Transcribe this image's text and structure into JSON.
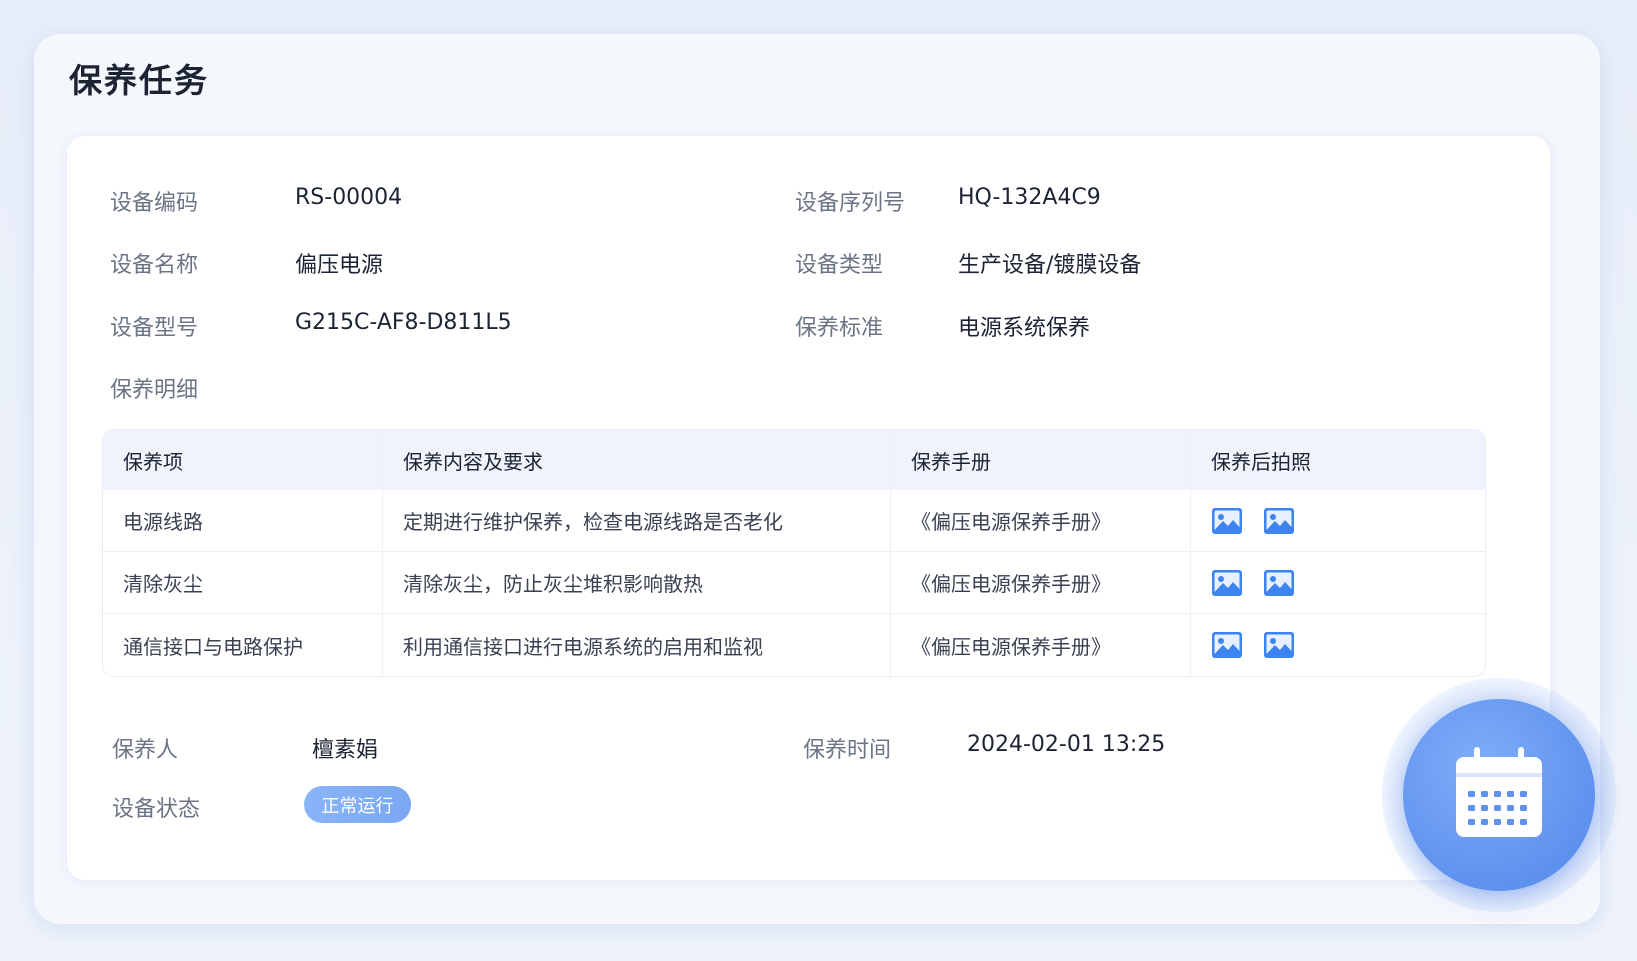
{
  "page": {
    "title": "保养任务"
  },
  "device": {
    "code_label": "设备编码",
    "code_value": "RS-00004",
    "serial_label": "设备序列号",
    "serial_value": "HQ-132A4C9",
    "name_label": "设备名称",
    "name_value": "偏压电源",
    "type_label": "设备类型",
    "type_value": "生产设备/镀膜设备",
    "model_label": "设备型号",
    "model_value": "G215C-AF8-D811L5",
    "standard_label": "保养标准",
    "standard_value": "电源系统保养"
  },
  "details": {
    "label": "保养明细",
    "columns": [
      "保养项",
      "保养内容及要求",
      "保养手册",
      "保养后拍照"
    ],
    "rows": [
      {
        "item": "电源线路",
        "content": "定期进行维护保养，检查电源线路是否老化",
        "manual": "《偏压电源保养手册》",
        "photos": [
          "image-icon",
          "image-icon"
        ]
      },
      {
        "item": "清除灰尘",
        "content": "清除灰尘，防止灰尘堆积影响散热",
        "manual": "《偏压电源保养手册》",
        "photos": [
          "image-icon",
          "image-icon"
        ]
      },
      {
        "item": "通信接口与电路保护",
        "content": "利用通信接口进行电源系统的启用和监视",
        "manual": "《偏压电源保养手册》",
        "photos": [
          "image-icon",
          "image-icon"
        ]
      }
    ]
  },
  "footer": {
    "maintainer_label": "保养人",
    "maintainer_value": "檀素娟",
    "time_label": "保养时间",
    "time_value": "2024-02-01 13:25",
    "status_label": "设备状态",
    "status_value": "正常运行"
  },
  "colors": {
    "accent": "#5f92ef",
    "status_badge": "#7aa7f3",
    "photo_icon": "#3d84f0",
    "title_text": "#1c2333",
    "label_text": "#6c7586"
  },
  "icons": {
    "fab": "calendar-icon",
    "photo": "image-icon"
  }
}
